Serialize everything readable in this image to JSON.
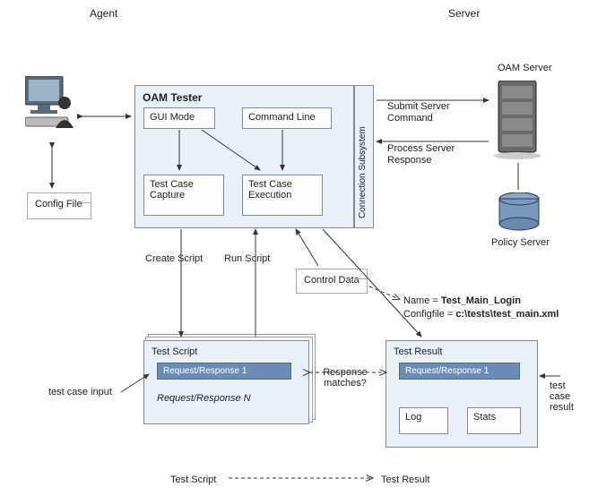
{
  "headings": {
    "agent": "Agent",
    "server": "Server"
  },
  "components": {
    "oam_tester": "OAM Tester",
    "gui_mode": "GUI Mode",
    "command_line": "Command Line",
    "test_case_capture": "Test Case Capture",
    "test_case_execution": "Test Case Execution",
    "connection_subsystem": "Connection Subsystem",
    "config_file": "Config File",
    "control_data": "Control Data",
    "test_script": "Test Script",
    "test_result": "Test Result",
    "req_resp_1": "Request/Response 1",
    "req_resp_n": "Request/Response N",
    "log": "Log",
    "stats": "Stats",
    "oam_server": "OAM Server",
    "policy_server": "Policy Server"
  },
  "labels": {
    "submit_cmd": "Submit Server Command",
    "process_resp": "Process Server Response",
    "create_script": "Create Script",
    "run_script": "Run Script",
    "response_matches": "Response matches?",
    "test_case_input": "test case input",
    "test_case_result": "test case result",
    "footer_left": "Test Script",
    "footer_right": "Test Result",
    "name_line_prefix": "Name = ",
    "name_line_value": "Test_Main_Login",
    "config_line_prefix": "Configfile = ",
    "config_line_value": "c:\\tests\\test_main.xml"
  },
  "icons": {
    "workstation": "workstation-icon",
    "server": "server-tower-icon",
    "database": "database-cylinder-icon",
    "person": "person-silhouette-icon"
  }
}
